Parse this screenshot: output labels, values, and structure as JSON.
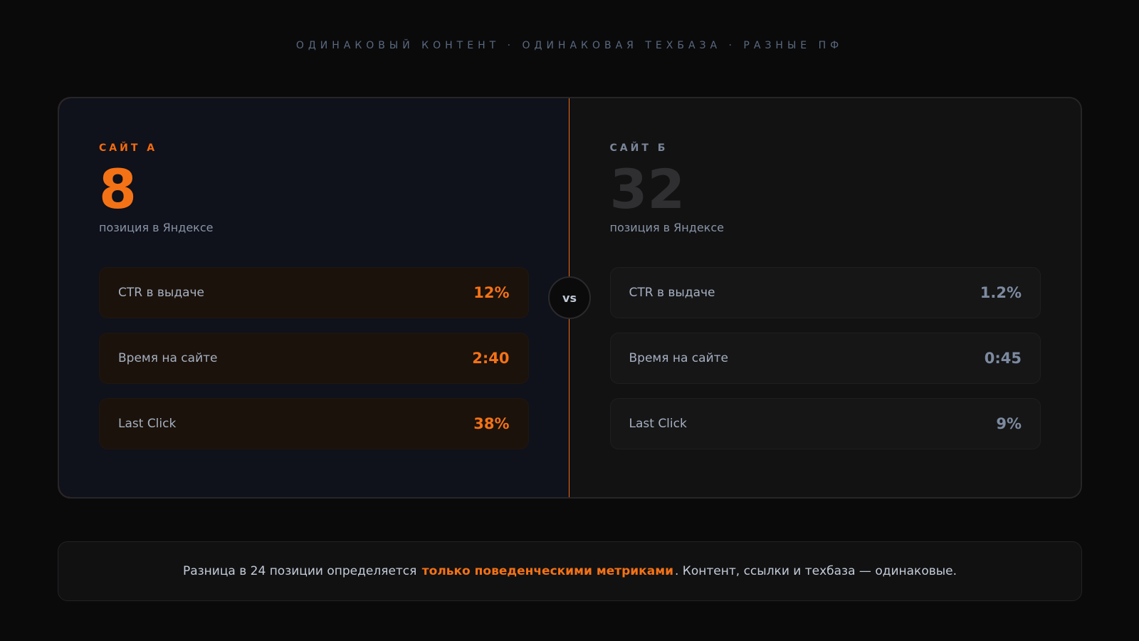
{
  "header": {
    "subtitle": "ОДИНАКОВЫЙ КОНТЕНТ · ОДИНАКОВАЯ ТЕХБАЗА · РАЗНЫЕ ПФ"
  },
  "site_a": {
    "label": "САЙТ А",
    "position": "8",
    "position_caption": "позиция в Яндексе",
    "metrics": [
      {
        "label": "CTR в выдаче",
        "value": "12%"
      },
      {
        "label": "Время на сайте",
        "value": "2:40"
      },
      {
        "label": "Last Click",
        "value": "38%"
      }
    ]
  },
  "site_b": {
    "label": "САЙТ Б",
    "position": "32",
    "position_caption": "позиция в Яндексе",
    "metrics": [
      {
        "label": "CTR в выдаче",
        "value": "1.2%"
      },
      {
        "label": "Время на сайте",
        "value": "0:45"
      },
      {
        "label": "Last Click",
        "value": "9%"
      }
    ]
  },
  "vs": "vs",
  "footer": {
    "before": "Разница в 24 позиции определяется",
    "highlight": "только поведенческими метриками",
    "after": ". Контент, ссылки и техбаза — одинаковые."
  },
  "colors": {
    "accent": "#f47216",
    "background": "#0a0a0b"
  }
}
